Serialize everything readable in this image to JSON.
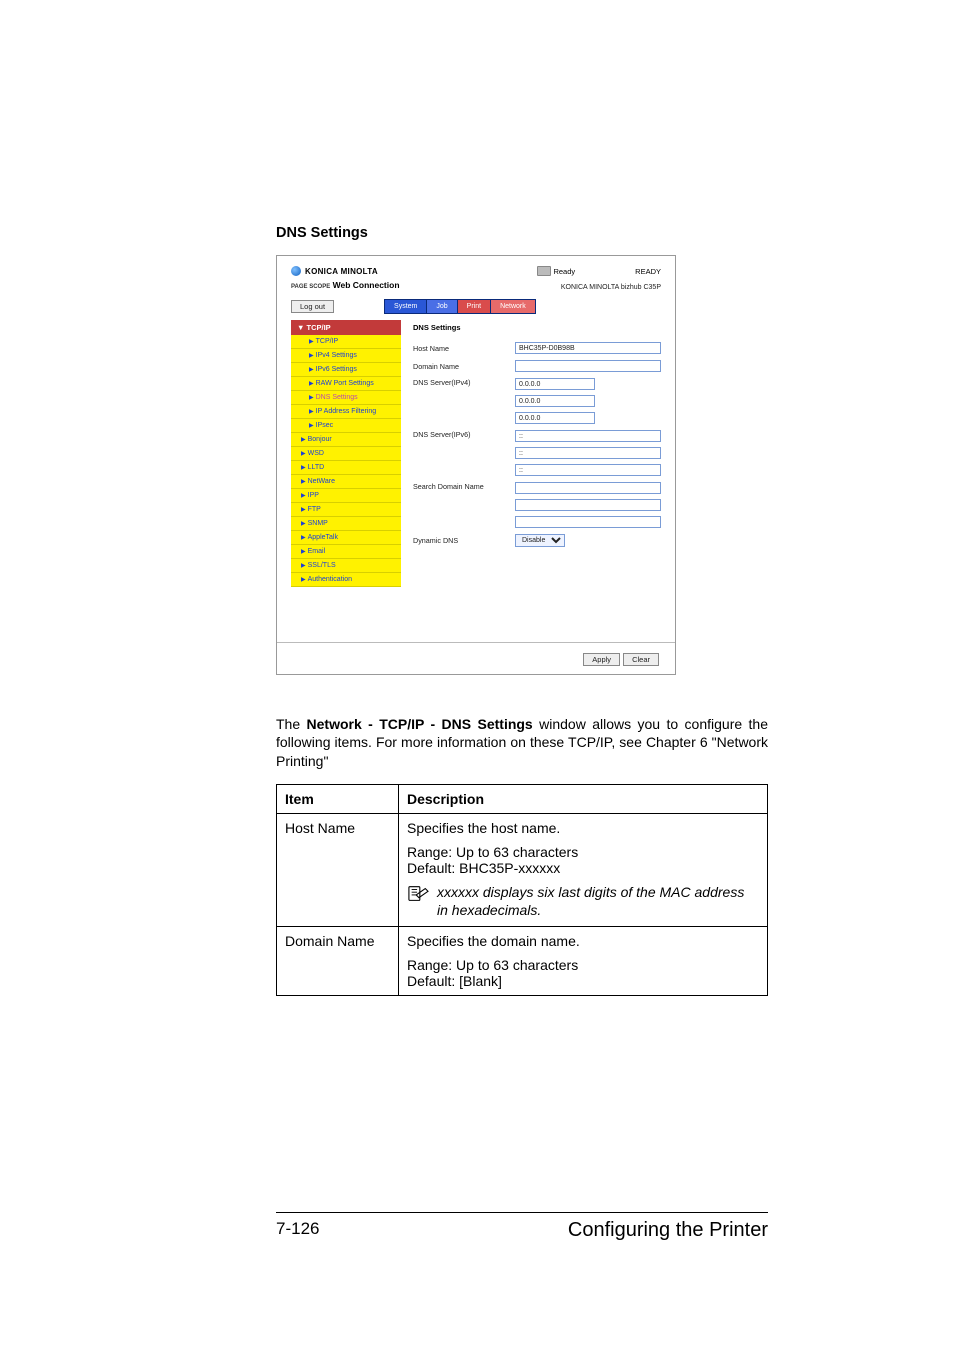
{
  "section_heading": "DNS Settings",
  "screenshot": {
    "brand": "KONICA MINOLTA",
    "pagescope_prefix": "PAGE SCOPE",
    "pagescope": "Web Connection",
    "status_ready_icon_text": "Ready",
    "status_ready": "READY",
    "model": "KONICA MINOLTA bizhub C35P",
    "logout": "Log out",
    "tabs": {
      "system": "System",
      "job": "Job",
      "print": "Print",
      "network": "Network"
    },
    "sidebar": {
      "head": "▼ TCP/IP",
      "items": [
        {
          "label": "TCP/IP",
          "indent": true
        },
        {
          "label": "IPv4 Settings",
          "indent": true
        },
        {
          "label": "IPv6 Settings",
          "indent": true
        },
        {
          "label": "RAW Port Settings",
          "indent": true
        },
        {
          "label": "DNS Settings",
          "indent": true,
          "active": true
        },
        {
          "label": "IP Address Filtering",
          "indent": true
        },
        {
          "label": "IPsec",
          "indent": true
        },
        {
          "label": "Bonjour",
          "indent": false
        },
        {
          "label": "WSD",
          "indent": false
        },
        {
          "label": "LLTD",
          "indent": false
        },
        {
          "label": "NetWare",
          "indent": false
        },
        {
          "label": "IPP",
          "indent": false
        },
        {
          "label": "FTP",
          "indent": false
        },
        {
          "label": "SNMP",
          "indent": false
        },
        {
          "label": "AppleTalk",
          "indent": false
        },
        {
          "label": "Email",
          "indent": false
        },
        {
          "label": "SSL/TLS",
          "indent": false
        },
        {
          "label": "Authentication",
          "indent": false
        }
      ]
    },
    "panel": {
      "title": "DNS Settings",
      "hostname_label": "Host Name",
      "hostname_value": "BHC35P-D0B98B",
      "domain_label": "Domain Name",
      "domain_value": "",
      "dns4_label": "DNS Server(IPv4)",
      "dns4_values": [
        "0.0.0.0",
        "0.0.0.0",
        "0.0.0.0"
      ],
      "dns6_label": "DNS Server(IPv6)",
      "dns6_values": [
        "::",
        "::",
        "::"
      ],
      "search_label": "Search Domain Name",
      "search_values": [
        "",
        "",
        ""
      ],
      "dyndns_label": "Dynamic DNS",
      "dyndns_value": "Disable",
      "apply": "Apply",
      "clear": "Clear"
    }
  },
  "body_text_parts": {
    "p1a": "The ",
    "p1b": "Network - TCP/IP - DNS Settings",
    "p1c": " window allows you to configure the following items. For more information on these TCP/IP, see Chapter 6 \"Network Printing\""
  },
  "table": {
    "head_item": "Item",
    "head_desc": "Description",
    "rows": [
      {
        "item": "Host Name",
        "desc_line1": "Specifies the host name.",
        "range": "Range:  Up to 63 characters",
        "default": "Default:  BHC35P-xxxxxx",
        "note": "xxxxxx displays six last digits of the MAC address in hexadecimals."
      },
      {
        "item": "Domain Name",
        "desc_line1": "Specifies the domain name.",
        "range": "Range:  Up to 63 characters",
        "default": "Default:  [Blank]"
      }
    ]
  },
  "footer": {
    "page": "7-126",
    "label": "Configuring the Printer"
  }
}
